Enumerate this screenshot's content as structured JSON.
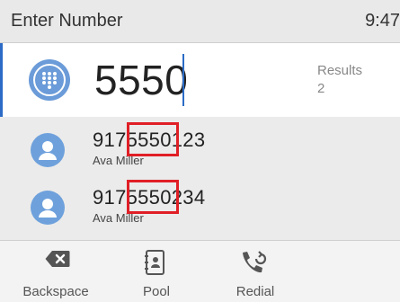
{
  "header": {
    "title": "Enter Number",
    "time": "9:47"
  },
  "entry": {
    "value": "5550",
    "results_label": "Results",
    "results_count": "2",
    "icon": "dialpad-icon"
  },
  "matches": [
    {
      "number": "9175550123",
      "name": "Ava Miller",
      "highlight": "5550"
    },
    {
      "number": "9175550234",
      "name": "Ava Miller",
      "highlight": "5550"
    }
  ],
  "softkeys": [
    {
      "label": "Backspace",
      "icon": "backspace-icon"
    },
    {
      "label": "Pool",
      "icon": "contact-book-icon"
    },
    {
      "label": "Redial",
      "icon": "redial-phone-icon"
    }
  ],
  "colors": {
    "accent": "#2c6cc7",
    "icon_blue": "#6b9bd8",
    "highlight_box": "#e01f26"
  }
}
